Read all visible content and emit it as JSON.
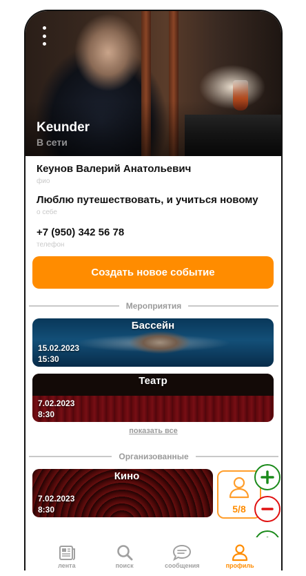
{
  "profile": {
    "nickname": "Keunder",
    "status": "В сети",
    "fields": [
      {
        "value": "Кеунов Валерий Анатольевич",
        "label": "фио"
      },
      {
        "value": "Люблю путешествовать, и учиться новому",
        "label": "о себе"
      },
      {
        "value": "+7 (950) 342 56 78",
        "label": "телефон"
      }
    ]
  },
  "actions": {
    "create_event": "Создать новое событие"
  },
  "events": {
    "title": "Мероприятия",
    "items": [
      {
        "title": "Бассейн",
        "date": "15.02.2023",
        "time": "15:30"
      },
      {
        "title": "Театр",
        "date": "7.02.2023",
        "time": "8:30"
      }
    ],
    "show_all": "показать все"
  },
  "organized": {
    "title": "Организованные",
    "items": [
      {
        "title": "Кино",
        "date": "7.02.2023",
        "time": "8:30",
        "participants": "5/8"
      }
    ]
  },
  "tabs": [
    {
      "label": "лента",
      "icon": "news-icon"
    },
    {
      "label": "поиск",
      "icon": "search-icon"
    },
    {
      "label": "сообщения",
      "icon": "chat-icon"
    },
    {
      "label": "профиль",
      "icon": "profile-icon",
      "active": true
    }
  ],
  "colors": {
    "accent": "#ff8c00",
    "add": "#1a8a1a",
    "remove": "#e01010",
    "muted": "#9a9a9a"
  }
}
